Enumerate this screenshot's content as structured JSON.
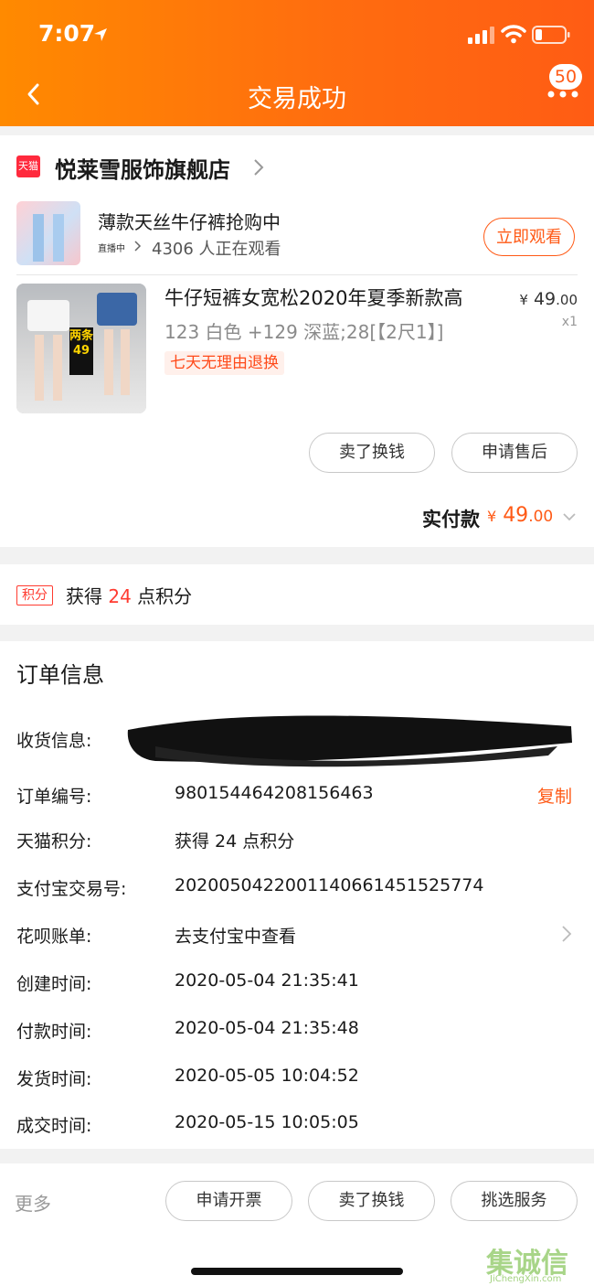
{
  "status_bar": {
    "time": "7:07"
  },
  "nav": {
    "title": "交易成功",
    "badge_count": "50"
  },
  "store": {
    "logo_text": "天猫",
    "name": "悦莱雪服饰旗舰店"
  },
  "live": {
    "title": "薄款天丝牛仔裤抢购中",
    "tag": "直播中",
    "viewers": "4306 人正在观看",
    "watch_button": "立即观看"
  },
  "product": {
    "promo_text": "两条49",
    "title": "牛仔短裤女宽松2020年夏季新款高",
    "spec": "123 白色 +129 深蓝;28[【2尺1】]",
    "tag": "七天无理由退换",
    "price_symbol": "¥",
    "price_int": "49",
    "price_dec": ".00",
    "qty": "x1"
  },
  "product_actions": {
    "sell_button": "卖了换钱",
    "after_sale_button": "申请售后"
  },
  "payment": {
    "label": "实付款",
    "currency": "¥",
    "amount_int": "49",
    "amount_dec": ".00"
  },
  "points": {
    "tag": "积分",
    "prefix": "获得",
    "value": "24",
    "suffix": "点积分"
  },
  "order_info": {
    "title": "订单信息",
    "rows": [
      {
        "label": "收货信息:",
        "value": ""
      },
      {
        "label": "订单编号:",
        "value": "980154464208156463"
      },
      {
        "label": "天猫积分:",
        "value": "获得 24 点积分"
      },
      {
        "label": "支付宝交易号:",
        "value": "2020050422001140661451525774"
      },
      {
        "label": "花呗账单:",
        "value": "去支付宝中查看"
      },
      {
        "label": "创建时间:",
        "value": "2020-05-04 21:35:41"
      },
      {
        "label": "付款时间:",
        "value": "2020-05-04 21:35:48"
      },
      {
        "label": "发货时间:",
        "value": "2020-05-05 10:04:52"
      },
      {
        "label": "成交时间:",
        "value": "2020-05-15 10:05:05"
      }
    ],
    "copy_label": "复制"
  },
  "bottom_bar": {
    "more_label": "更多",
    "invoice_button": "申请开票",
    "sell_button": "卖了换钱",
    "service_button": "挑选服务"
  },
  "watermark": {
    "text": "集诚信",
    "sub": "JiChengXin.com"
  },
  "colors": {
    "accent": "#ff5a16",
    "header_start": "#ff8a00",
    "header_end": "#ff5c14",
    "points_red": "#ff3b30"
  }
}
